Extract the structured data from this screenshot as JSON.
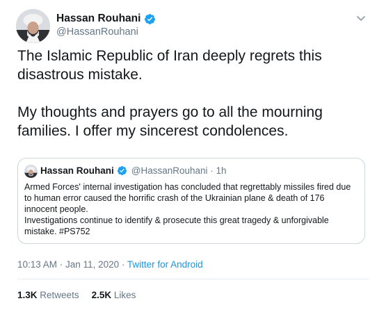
{
  "author": {
    "name": "Hassan Rouhani",
    "handle": "@HassanRouhani"
  },
  "tweet": {
    "paragraphs": [
      "The Islamic Republic of Iran deeply regrets this disastrous mistake.",
      "My thoughts and prayers go to all the mourning families. I offer my sincerest condolences."
    ],
    "timestamp": "10:13 AM · Jan 11, 2020 · ",
    "source": "Twitter for Android"
  },
  "quoted_tweet": {
    "name": "Hassan Rouhani",
    "handle": "@HassanRouhani · 1h",
    "lines": [
      "Armed Forces' internal investigation has concluded that regrettably missiles fired due to human error caused the horrific crash of the Ukrainian plane & death of 176 innocent people.",
      "Investigations continue to identify & prosecute this great tragedy & unforgivable mistake. #PS752"
    ]
  },
  "stats": {
    "retweets_count": "1.3K",
    "retweets_label": "Retweets",
    "likes_count": "2.5K",
    "likes_label": "Likes"
  },
  "icons": {
    "verified": "verified-badge-icon",
    "menu": "chevron-down-icon"
  },
  "colors": {
    "accent": "#1b95e0",
    "verified": "#1da1f2",
    "secondary_text": "#657786",
    "border": "#ccd6dd"
  }
}
